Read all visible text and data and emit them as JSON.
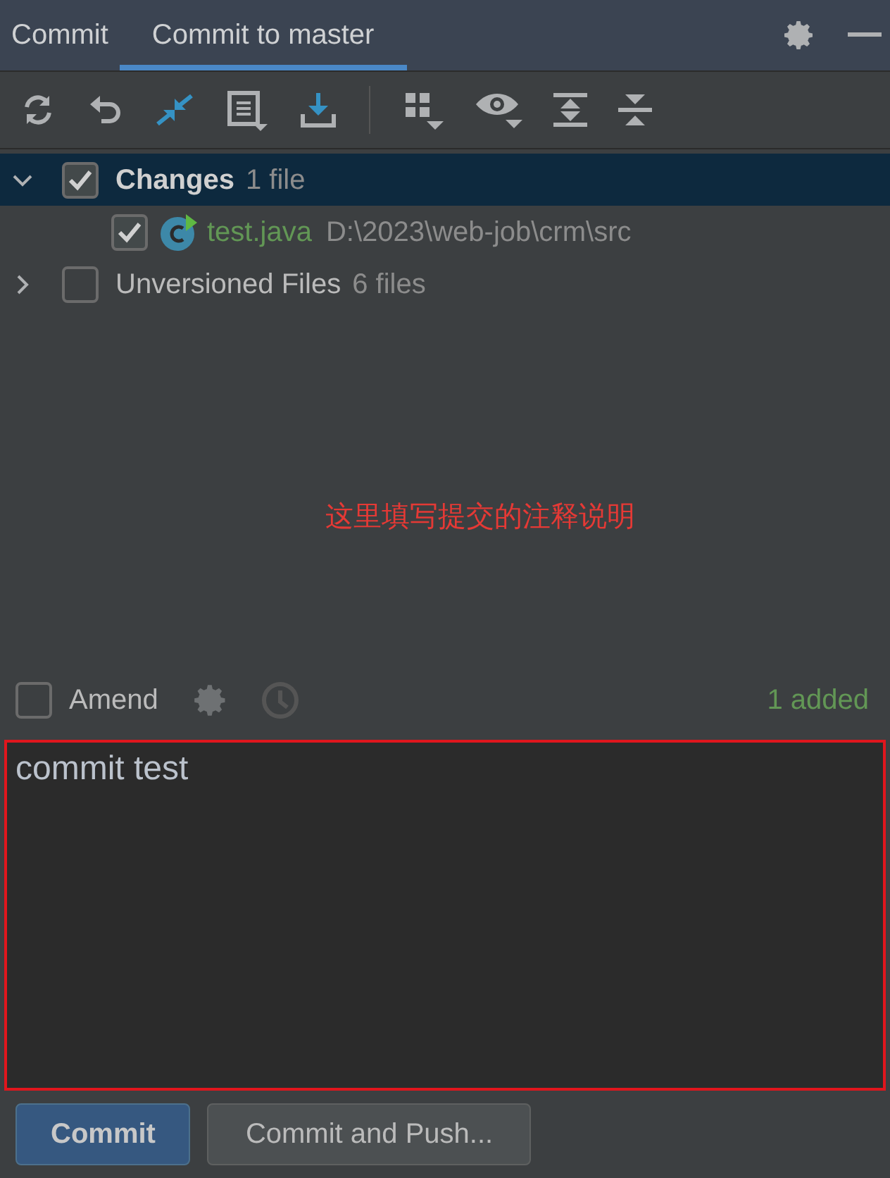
{
  "tabs": [
    {
      "label": "Commit",
      "selected": false
    },
    {
      "label": "Commit to master",
      "selected": true
    }
  ],
  "tree": [
    {
      "label": "Changes",
      "count": "1 file",
      "checked": true,
      "expanded": true,
      "selected": true,
      "children": [
        {
          "name": "test.java",
          "path": "D:\\2023\\web-job\\crm\\src",
          "checked": true
        }
      ]
    },
    {
      "label": "Unversioned Files",
      "count": "6 files",
      "checked": false,
      "expanded": false,
      "selected": false
    }
  ],
  "annotation": "这里填写提交的注释说明",
  "amend": {
    "label": "Amend",
    "checked": false
  },
  "summary": "1 added",
  "message": {
    "value": "commit test"
  },
  "buttons": [
    {
      "label": "Commit",
      "kind": "primary"
    },
    {
      "label": "Commit and Push...",
      "kind": "secondary"
    }
  ]
}
